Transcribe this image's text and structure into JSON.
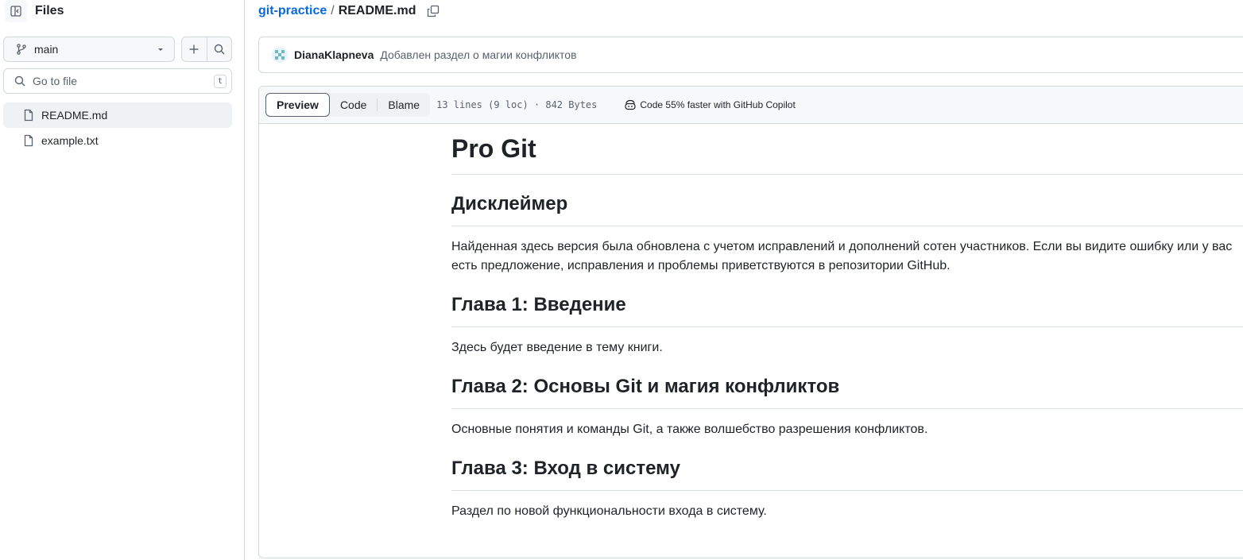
{
  "sidebar": {
    "title": "Files",
    "branch": "main",
    "search_placeholder": "Go to file",
    "search_shortcut": "t",
    "files": [
      {
        "name": "README.md",
        "active": true
      },
      {
        "name": "example.txt",
        "active": false
      }
    ]
  },
  "breadcrumb": {
    "repo": "git-practice",
    "separator": "/",
    "file": "README.md"
  },
  "commit": {
    "author": "DianaKlapneva",
    "message": "Добавлен раздел о магии конфликтов"
  },
  "file_header": {
    "tabs": [
      "Preview",
      "Code",
      "Blame"
    ],
    "active_tab": "Preview",
    "info": "13 lines (9 loc) · 842 Bytes",
    "copilot": "Code 55% faster with GitHub Copilot"
  },
  "readme": {
    "h1": "Pro Git",
    "sections": [
      {
        "heading": "Дисклеймер",
        "text": "Найденная здесь версия была обновлена с учетом исправлений и дополнений сотен участников. Если вы видите ошибку или у вас есть предложение, исправления и проблемы приветствуются в репозитории GitHub."
      },
      {
        "heading": "Глава 1: Введение",
        "text": "Здесь будет введение в тему книги."
      },
      {
        "heading": "Глава 2: Основы Git и магия конфликтов",
        "text": "Основные понятия и команды Git, а также волшебство разрешения конфликтов."
      },
      {
        "heading": "Глава 3: Вход в систему",
        "text": "Раздел по новой функциональности входа в систему."
      }
    ]
  },
  "colors": {
    "link": "#0969da",
    "text": "#1f2328",
    "muted": "#59636e",
    "border": "#d0d7de"
  }
}
